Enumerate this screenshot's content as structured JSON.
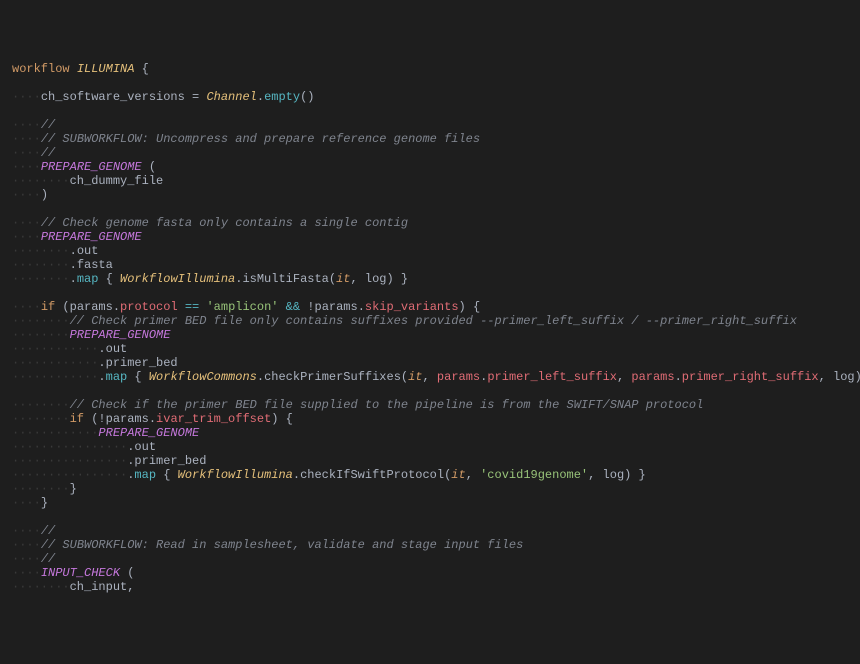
{
  "lines": [
    {
      "segs": [
        {
          "t": "workflow ",
          "c": "kw"
        },
        {
          "t": "ILLUMINA",
          "c": "type"
        },
        {
          "t": " {",
          "c": "pun"
        }
      ]
    },
    {
      "segs": []
    },
    {
      "segs": [
        {
          "t": "····",
          "c": "ws"
        },
        {
          "t": "ch_software_versions",
          "c": "plain"
        },
        {
          "t": " = ",
          "c": "pun"
        },
        {
          "t": "Channel",
          "c": "type"
        },
        {
          "t": ".",
          "c": "pun"
        },
        {
          "t": "empty",
          "c": "fn"
        },
        {
          "t": "()",
          "c": "pun"
        }
      ]
    },
    {
      "segs": []
    },
    {
      "segs": [
        {
          "t": "····",
          "c": "ws"
        },
        {
          "t": "//",
          "c": "cmt"
        }
      ]
    },
    {
      "segs": [
        {
          "t": "····",
          "c": "ws"
        },
        {
          "t": "// SUBWORKFLOW: Uncompress and prepare reference genome files",
          "c": "cmt"
        }
      ]
    },
    {
      "segs": [
        {
          "t": "····",
          "c": "ws"
        },
        {
          "t": "//",
          "c": "cmt"
        }
      ]
    },
    {
      "segs": [
        {
          "t": "····",
          "c": "ws"
        },
        {
          "t": "PREPARE_GENOME",
          "c": "call"
        },
        {
          "t": " (",
          "c": "pun"
        }
      ]
    },
    {
      "segs": [
        {
          "t": "········",
          "c": "ws"
        },
        {
          "t": "ch_dummy_file",
          "c": "plain"
        }
      ]
    },
    {
      "segs": [
        {
          "t": "····",
          "c": "ws"
        },
        {
          "t": ")",
          "c": "pun"
        }
      ]
    },
    {
      "segs": []
    },
    {
      "segs": [
        {
          "t": "····",
          "c": "ws"
        },
        {
          "t": "// Check genome fasta only contains a single contig",
          "c": "cmt"
        }
      ]
    },
    {
      "segs": [
        {
          "t": "····",
          "c": "ws"
        },
        {
          "t": "PREPARE_GENOME",
          "c": "call"
        }
      ]
    },
    {
      "segs": [
        {
          "t": "········",
          "c": "ws"
        },
        {
          "t": ".",
          "c": "pun"
        },
        {
          "t": "out",
          "c": "plain"
        }
      ]
    },
    {
      "segs": [
        {
          "t": "········",
          "c": "ws"
        },
        {
          "t": ".",
          "c": "pun"
        },
        {
          "t": "fasta",
          "c": "plain"
        }
      ]
    },
    {
      "segs": [
        {
          "t": "········",
          "c": "ws"
        },
        {
          "t": ".",
          "c": "pun"
        },
        {
          "t": "map",
          "c": "fn"
        },
        {
          "t": " { ",
          "c": "pun"
        },
        {
          "t": "WorkflowIllumina",
          "c": "type"
        },
        {
          "t": ".",
          "c": "pun"
        },
        {
          "t": "isMultiFasta",
          "c": "plain"
        },
        {
          "t": "(",
          "c": "pun"
        },
        {
          "t": "it",
          "c": "param"
        },
        {
          "t": ", ",
          "c": "pun"
        },
        {
          "t": "log",
          "c": "plain"
        },
        {
          "t": ") }",
          "c": "pun"
        }
      ]
    },
    {
      "segs": []
    },
    {
      "segs": [
        {
          "t": "····",
          "c": "ws"
        },
        {
          "t": "if",
          "c": "kw"
        },
        {
          "t": " (",
          "c": "pun"
        },
        {
          "t": "params",
          "c": "plain"
        },
        {
          "t": ".",
          "c": "pun"
        },
        {
          "t": "protocol",
          "c": "prop"
        },
        {
          "t": " == ",
          "c": "fn"
        },
        {
          "t": "'amplicon'",
          "c": "str"
        },
        {
          "t": " && ",
          "c": "fn"
        },
        {
          "t": "!",
          "c": "pun"
        },
        {
          "t": "params",
          "c": "plain"
        },
        {
          "t": ".",
          "c": "pun"
        },
        {
          "t": "skip_variants",
          "c": "prop"
        },
        {
          "t": ") {",
          "c": "pun"
        }
      ]
    },
    {
      "segs": [
        {
          "t": "········",
          "c": "ws"
        },
        {
          "t": "// Check primer BED file only contains suffixes provided --primer_left_suffix / --primer_right_suffix",
          "c": "cmt"
        }
      ]
    },
    {
      "segs": [
        {
          "t": "········",
          "c": "ws"
        },
        {
          "t": "PREPARE_GENOME",
          "c": "call"
        }
      ]
    },
    {
      "segs": [
        {
          "t": "············",
          "c": "ws"
        },
        {
          "t": ".",
          "c": "pun"
        },
        {
          "t": "out",
          "c": "plain"
        }
      ]
    },
    {
      "segs": [
        {
          "t": "············",
          "c": "ws"
        },
        {
          "t": ".",
          "c": "pun"
        },
        {
          "t": "primer_bed",
          "c": "plain"
        }
      ]
    },
    {
      "segs": [
        {
          "t": "············",
          "c": "ws"
        },
        {
          "t": ".",
          "c": "pun"
        },
        {
          "t": "map",
          "c": "fn"
        },
        {
          "t": " { ",
          "c": "pun"
        },
        {
          "t": "WorkflowCommons",
          "c": "type"
        },
        {
          "t": ".",
          "c": "pun"
        },
        {
          "t": "checkPrimerSuffixes",
          "c": "plain"
        },
        {
          "t": "(",
          "c": "pun"
        },
        {
          "t": "it",
          "c": "param"
        },
        {
          "t": ", ",
          "c": "pun"
        },
        {
          "t": "params",
          "c": "prop"
        },
        {
          "t": ".",
          "c": "pun"
        },
        {
          "t": "primer_left_suffix",
          "c": "prop"
        },
        {
          "t": ", ",
          "c": "pun"
        },
        {
          "t": "params",
          "c": "prop"
        },
        {
          "t": ".",
          "c": "pun"
        },
        {
          "t": "primer_right_suffix",
          "c": "prop"
        },
        {
          "t": ", ",
          "c": "pun"
        },
        {
          "t": "log",
          "c": "plain"
        },
        {
          "t": ") }",
          "c": "pun"
        }
      ]
    },
    {
      "segs": []
    },
    {
      "segs": [
        {
          "t": "········",
          "c": "ws"
        },
        {
          "t": "// Check if the primer BED file supplied to the pipeline is from the SWIFT/SNAP protocol",
          "c": "cmt"
        }
      ]
    },
    {
      "segs": [
        {
          "t": "········",
          "c": "ws"
        },
        {
          "t": "if",
          "c": "kw"
        },
        {
          "t": " (",
          "c": "pun"
        },
        {
          "t": "!",
          "c": "pun"
        },
        {
          "t": "params",
          "c": "plain"
        },
        {
          "t": ".",
          "c": "pun"
        },
        {
          "t": "ivar_trim_offset",
          "c": "prop"
        },
        {
          "t": ") {",
          "c": "pun"
        }
      ]
    },
    {
      "segs": [
        {
          "t": "············",
          "c": "ws"
        },
        {
          "t": "PREPARE_GENOME",
          "c": "call"
        }
      ]
    },
    {
      "segs": [
        {
          "t": "················",
          "c": "ws"
        },
        {
          "t": ".",
          "c": "pun"
        },
        {
          "t": "out",
          "c": "plain"
        }
      ]
    },
    {
      "segs": [
        {
          "t": "················",
          "c": "ws"
        },
        {
          "t": ".",
          "c": "pun"
        },
        {
          "t": "primer_bed",
          "c": "plain"
        }
      ]
    },
    {
      "segs": [
        {
          "t": "················",
          "c": "ws"
        },
        {
          "t": ".",
          "c": "pun"
        },
        {
          "t": "map",
          "c": "fn"
        },
        {
          "t": " { ",
          "c": "pun"
        },
        {
          "t": "WorkflowIllumina",
          "c": "type"
        },
        {
          "t": ".",
          "c": "pun"
        },
        {
          "t": "checkIfSwiftProtocol",
          "c": "plain"
        },
        {
          "t": "(",
          "c": "pun"
        },
        {
          "t": "it",
          "c": "param"
        },
        {
          "t": ", ",
          "c": "pun"
        },
        {
          "t": "'covid19genome'",
          "c": "str"
        },
        {
          "t": ", ",
          "c": "pun"
        },
        {
          "t": "log",
          "c": "plain"
        },
        {
          "t": ") }",
          "c": "pun"
        }
      ]
    },
    {
      "segs": [
        {
          "t": "········",
          "c": "ws"
        },
        {
          "t": "}",
          "c": "pun"
        }
      ]
    },
    {
      "segs": [
        {
          "t": "····",
          "c": "ws"
        },
        {
          "t": "}",
          "c": "pun"
        }
      ]
    },
    {
      "segs": []
    },
    {
      "segs": [
        {
          "t": "····",
          "c": "ws"
        },
        {
          "t": "//",
          "c": "cmt"
        }
      ]
    },
    {
      "segs": [
        {
          "t": "····",
          "c": "ws"
        },
        {
          "t": "// SUBWORKFLOW: Read in samplesheet, validate and stage input files",
          "c": "cmt"
        }
      ]
    },
    {
      "segs": [
        {
          "t": "····",
          "c": "ws"
        },
        {
          "t": "//",
          "c": "cmt"
        }
      ]
    },
    {
      "segs": [
        {
          "t": "····",
          "c": "ws"
        },
        {
          "t": "INPUT_CHECK",
          "c": "call"
        },
        {
          "t": " (",
          "c": "pun"
        }
      ]
    },
    {
      "segs": [
        {
          "t": "········",
          "c": "ws"
        },
        {
          "t": "ch_input",
          "c": "plain"
        },
        {
          "t": ",",
          "c": "pun"
        }
      ]
    }
  ]
}
